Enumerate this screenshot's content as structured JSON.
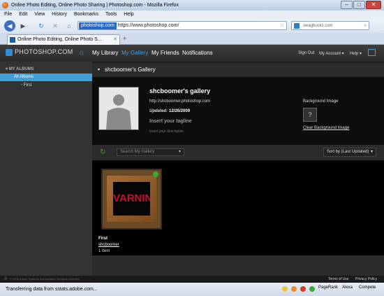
{
  "window": {
    "title": "Online Photo Editing, Online Photo Sharing | Photoshop.com - Mozilla Firefox"
  },
  "menu": [
    "File",
    "Edit",
    "View",
    "History",
    "Bookmarks",
    "Tools",
    "Help"
  ],
  "nav": {
    "url_site": "photoshop.com",
    "url": "https://www.photoshop.com/",
    "search_placeholder": "swagbucks.com"
  },
  "tab": {
    "title": "Online Photo Editing, Online Photo S..."
  },
  "app": {
    "logo": "PHOTOSHOP.COM",
    "links": [
      "My Library",
      "My Gallery",
      "My Friends",
      "Notifications"
    ],
    "right": {
      "signout": "Sign Out",
      "account": "My Account ▾",
      "help": "Help ▾"
    },
    "accent": "#3e9fd9"
  },
  "sidebar": {
    "header": "MY ALBUMS",
    "items": [
      {
        "label": "All Albums"
      },
      {
        "label": "First"
      }
    ]
  },
  "gallery": {
    "header": "shcboomer's Gallery",
    "name": "shcboomer's gallery",
    "url": "http://shcboomer.photoshop.com",
    "updated_label": "Updated:",
    "updated_date": "12/26/2009",
    "tagline": "Insert your tagline",
    "description": "Insert your description",
    "bg_label": "Background Image",
    "bg_q": "?",
    "clear_bg": "Clear Background Image",
    "search_placeholder": "Search My Gallery",
    "sort": "Sort by (Last Updated)",
    "album": {
      "title": "First",
      "owner": "shcboomer",
      "count": "1 item",
      "thumb_text": "VARNIN"
    }
  },
  "footer": {
    "copyright": "© 2008 Adobe Systems Incorporated. All rights reserved.",
    "terms": "Terms of Use",
    "privacy": "Privacy Policy"
  },
  "status": {
    "text": "Transferring data from sstats.adobe.com...",
    "pagerank": "PageRank",
    "alexa": "Alexa",
    "compete": "Compete"
  }
}
